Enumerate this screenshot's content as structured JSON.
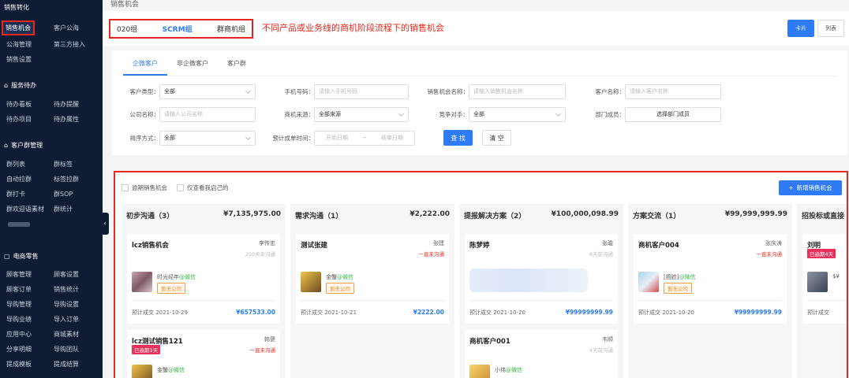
{
  "breadcrumb": "销售机会",
  "annotation": "不同产品或业务线的商机阶段流程下的销售机会",
  "groups": [
    "020组",
    "SCRM组",
    "群商机组"
  ],
  "view_buttons": {
    "card": "卡片",
    "list": "列表"
  },
  "sidebar": {
    "sections": [
      {
        "title": "销售转化",
        "icon": "",
        "rows": [
          [
            "销售机会",
            "客户公海"
          ],
          [
            "公海管理",
            "第三方接入"
          ],
          [
            "销售设置",
            ""
          ]
        ]
      },
      {
        "title": "服务待办",
        "icon": "⌂",
        "rows": [
          [
            "待办看板",
            "待办提醒"
          ],
          [
            "待办项目",
            "待办属性"
          ]
        ]
      },
      {
        "title": "客户群管理",
        "icon": "⌂",
        "rows": [
          [
            "群列表",
            "群标签"
          ],
          [
            "自动拉群",
            "标签拉群"
          ],
          [
            "群打卡",
            "群SOP"
          ],
          [
            "群欢迎语素材",
            "群统计"
          ]
        ]
      },
      {
        "title": "电商零售",
        "icon": "▢",
        "rows": [
          [
            "顾客管理",
            "顾客设置"
          ],
          [
            "顾客订单",
            "销售统计"
          ],
          [
            "导购管理",
            "导购设置"
          ],
          [
            "导购业绩",
            "导入订单"
          ],
          [
            "应用中心",
            "商城素材"
          ],
          [
            "分享明细",
            "导购团队"
          ],
          [
            "提成模板",
            "提成结算"
          ]
        ]
      }
    ]
  },
  "tabs": [
    "企微客户",
    "非企微客户",
    "客户群"
  ],
  "filters": {
    "customer_type": {
      "label": "客户类型：",
      "value": "全部"
    },
    "phone": {
      "label": "手机号码：",
      "placeholder": "请输入手机号码"
    },
    "opportunity_name": {
      "label": "销售机会名称：",
      "placeholder": "请输入销售机会名称"
    },
    "customer_name": {
      "label": "客户名称：",
      "placeholder": "请输入客户名称"
    },
    "company": {
      "label": "公司名称：",
      "placeholder": "请输入公司名称"
    },
    "source": {
      "label": "商机来源：",
      "value": "全部来源"
    },
    "competitor": {
      "label": "竞争对手：",
      "value": "全部"
    },
    "department": {
      "label": "部门成员：",
      "value": "选择部门成员"
    },
    "sort": {
      "label": "排序方式：",
      "value": "全部"
    },
    "expected_date": {
      "label": "预计成单时间：",
      "start": "开始日期",
      "sep": "~",
      "end": "结束日期"
    },
    "search_button": "查 找",
    "reset_button": "清 空"
  },
  "kanban": {
    "checkboxes": [
      "逾期销售机会",
      "仅查看我启己的"
    ],
    "new_button": "新增销售机会",
    "columns": [
      {
        "title": "初步沟通（3）",
        "amount": "¥7,135,975.00",
        "cards": [
          {
            "title": "lcz销售机会",
            "owner": "李传忠",
            "status": "250天未沟通",
            "status_style": "grey",
            "name": "时光经年",
            "wx": "@微信",
            "company": "暂无公司",
            "date": "预计成交 2021-10-29",
            "amount": "¥657533.00"
          },
          {
            "title": "lcz测试销售121",
            "owner": "韩健",
            "status": "一直未沟通",
            "tag": "已逾期3天",
            "name": "金蟹",
            "wx": "@微信"
          }
        ]
      },
      {
        "title": "需求沟通（1）",
        "amount": "¥2,222.00",
        "cards": [
          {
            "title": "测试张建",
            "owner": "张建",
            "status": "一直未沟通",
            "name": "金蟹",
            "wx": "@微信",
            "company": "暂无公司",
            "date": "预计成交 2021-10-21",
            "amount": "¥2222.00"
          }
        ]
      },
      {
        "title": "提报解决方案（2）",
        "amount": "¥100,000,098.99",
        "cards": [
          {
            "title": "陈梦婷",
            "owner": "张璇",
            "status": "8天前沟通",
            "status_style": "grey",
            "blurred": true,
            "date": "预计成交 2021-10-20",
            "amount": "¥99999999.99"
          },
          {
            "title": "商机客户001",
            "owner": "韦顺",
            "status": "4天前沟通",
            "status_style": "grey",
            "name": "小伟",
            "wx": "@微信"
          }
        ]
      },
      {
        "title": "方案交流（1）",
        "amount": "¥99,999,999.99",
        "cards": [
          {
            "title": "商机客户004",
            "owner": "张庆涛",
            "status": "一直未沟通",
            "name": "[捂脸]",
            "wx": "@微信",
            "company": "暂无公司",
            "date": "预计成交 2021-10-20",
            "amount": "¥99999999.99"
          }
        ]
      },
      {
        "title": "招投标或直接",
        "amount": "",
        "cards": [
          {
            "title": "刘明",
            "owner": "",
            "status": "",
            "tag": "已逾期4天",
            "name": "$¥",
            "wx": "",
            "date": "预计成交"
          }
        ]
      }
    ]
  },
  "colors": {
    "accent": "#2f7bf5",
    "highlight": "#e8281c",
    "sidebar": "#0f1c33",
    "wechat": "#3ab54a",
    "tag": "#e8305a"
  }
}
